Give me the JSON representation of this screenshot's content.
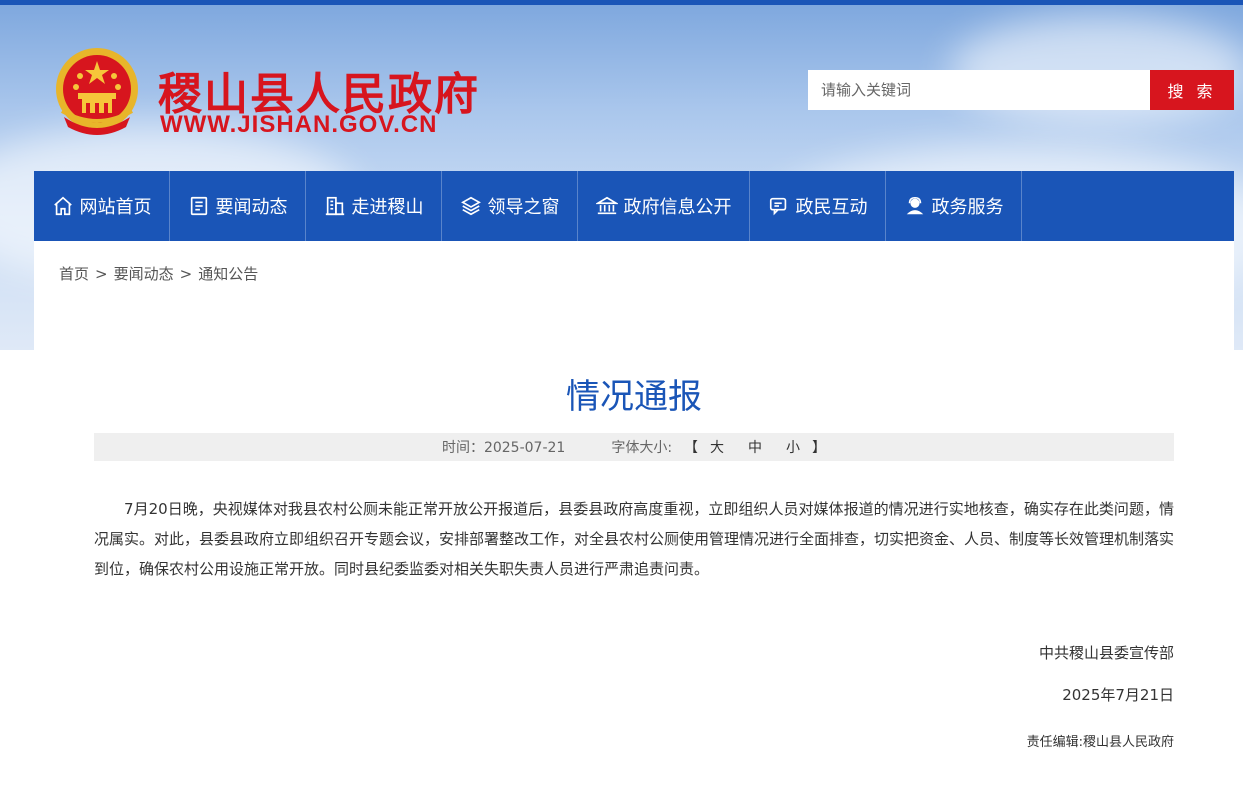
{
  "header": {
    "title": "稷山县人民政府",
    "url": "WWW.JISHAN.GOV.CN",
    "emblem_icon": "national-emblem-icon"
  },
  "search": {
    "placeholder": "请输入关键词",
    "button_label": "搜 索"
  },
  "nav": {
    "items": [
      {
        "label": "网站首页",
        "icon": "home-icon"
      },
      {
        "label": "要闻动态",
        "icon": "news-icon"
      },
      {
        "label": "走进稷山",
        "icon": "building-icon"
      },
      {
        "label": "领导之窗",
        "icon": "layers-icon"
      },
      {
        "label": "政府信息公开",
        "icon": "government-icon"
      },
      {
        "label": "政民互动",
        "icon": "chat-icon"
      },
      {
        "label": "政务服务",
        "icon": "service-icon"
      }
    ]
  },
  "breadcrumb": {
    "items": [
      "首页",
      "要闻动态",
      "通知公告"
    ],
    "separator": ">"
  },
  "article": {
    "title": "情况通报",
    "time_label": "时间：2025-07-21",
    "font_size_label": "字体大小:",
    "bracket_open": "【",
    "bracket_close": "】",
    "font_large": "大",
    "font_medium": "中",
    "font_small": "小",
    "body": "7月20日晚，央视媒体对我县农村公厕未能正常开放公开报道后，县委县政府高度重视，立即组织人员对媒体报道的情况进行实地核查，确实存在此类问题，情况属实。对此，县委县政府立即组织召开专题会议，安排部署整改工作，对全县农村公厕使用管理情况进行全面排查，切实把资金、人员、制度等长效管理机制落实到位，确保农村公用设施正常开放。同时县纪委监委对相关失职失责人员进行严肃追责问责。",
    "signature_org": "中共稷山县委宣传部",
    "signature_date": "2025年7月21日",
    "editor": "责任编辑:稷山县人民政府"
  },
  "colors": {
    "brand_blue": "#1a55b7",
    "brand_red": "#d7151e"
  }
}
